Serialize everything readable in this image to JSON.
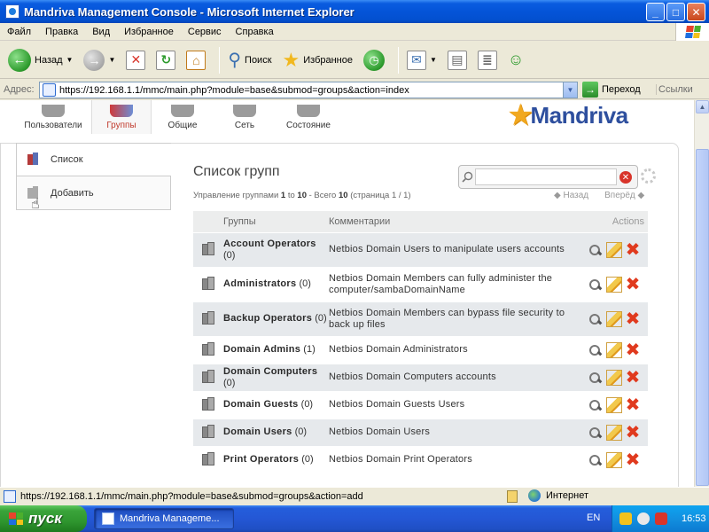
{
  "window": {
    "title": "Mandriva Management Console - Microsoft Internet Explorer",
    "minimize": "_",
    "maximize": "□",
    "close": "✕"
  },
  "menu": [
    "Файл",
    "Правка",
    "Вид",
    "Избранное",
    "Сервис",
    "Справка"
  ],
  "toolbar": {
    "back_label": "Назад",
    "search_label": "Поиск",
    "favorites_label": "Избранное"
  },
  "address": {
    "label": "Адрес:",
    "url": "https://192.168.1.1/mmc/main.php?module=base&submod=groups&action=index",
    "go_label": "Переход",
    "links_label": "Ссылки"
  },
  "modules": [
    {
      "label": "Пользователи"
    },
    {
      "label": "Группы"
    },
    {
      "label": "Общие"
    },
    {
      "label": "Сеть"
    },
    {
      "label": "Состояние"
    }
  ],
  "logo": {
    "brand": "Mandriva"
  },
  "sidebar": {
    "items": [
      {
        "label": "Список"
      },
      {
        "label": "Добавить"
      }
    ]
  },
  "main": {
    "title": "Список групп",
    "summary_prefix": "Управление группами ",
    "range_from": "1",
    "range_to_word": " to ",
    "range_to": "10",
    "total_prefix": " - Всего ",
    "total": "10",
    "page_info": " (страница 1 / 1)",
    "prev_label": "◆ Назад",
    "next_label": "Вперёд ◆",
    "search_placeholder": ""
  },
  "table": {
    "headers": {
      "groups": "Группы",
      "comments": "Комментарии",
      "actions": "Actions"
    },
    "rows": [
      {
        "name": "Account Operators",
        "count": "(0)",
        "comment": "Netbios Domain Users to manipulate users accounts"
      },
      {
        "name": "Administrators",
        "count": "(0)",
        "comment": "Netbios Domain Members can fully administer the computer/sambaDomainName"
      },
      {
        "name": "Backup Operators",
        "count": "(0)",
        "comment": "Netbios Domain Members can bypass file security to back up files"
      },
      {
        "name": "Domain Admins",
        "count": "(1)",
        "comment": "Netbios Domain Administrators"
      },
      {
        "name": "Domain Computers",
        "count": "(0)",
        "comment": "Netbios Domain Computers accounts"
      },
      {
        "name": "Domain Guests",
        "count": "(0)",
        "comment": "Netbios Domain Guests Users"
      },
      {
        "name": "Domain Users",
        "count": "(0)",
        "comment": "Netbios Domain Users"
      },
      {
        "name": "Print Operators",
        "count": "(0)",
        "comment": "Netbios Domain Print Operators"
      }
    ]
  },
  "status": {
    "url": "https://192.168.1.1/mmc/main.php?module=base&submod=groups&action=add",
    "zone": "Интернет"
  },
  "taskbar": {
    "start": "пуск",
    "task": "Mandriva Manageme...",
    "lang": "EN",
    "clock": "16:53"
  }
}
